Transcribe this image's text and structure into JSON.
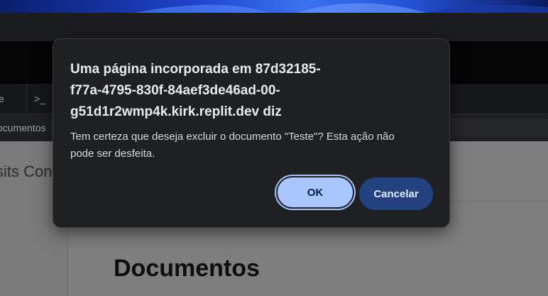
{
  "background": {
    "tab_fragment_left": "e",
    "terminal_tab_label": ">_",
    "path_text": "ocumentos",
    "page_title_fragment": "sits Con",
    "page_heading": "Documentos"
  },
  "dialog": {
    "title_lines": [
      "Uma página incorporada em 87d32185-",
      "f77a-4795-830f-84aef3de46ad-00-",
      "g51d1r2wmp4k.kirk.replit.dev diz"
    ],
    "message_lines": [
      "Tem certeza que deseja excluir o documento \"Teste\"? Esta ação não",
      "pode ser desfeita."
    ],
    "ok_label": "OK",
    "cancel_label": "Cancelar"
  },
  "colors": {
    "dialog_bg": "#1f2023",
    "ok_button": "#aac6ff",
    "cancel_button": "#24427f"
  }
}
